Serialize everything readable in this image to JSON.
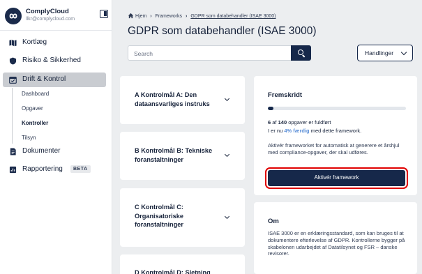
{
  "sidebar": {
    "org": {
      "name": "ComplyCloud",
      "email": "llkr@complycloud.com"
    },
    "items": [
      {
        "label": "Kortlæg",
        "icon": "map-icon"
      },
      {
        "label": "Risiko & Sikkerhed",
        "icon": "shield-icon"
      },
      {
        "label": "Drift & Kontrol",
        "icon": "calendar-check-icon",
        "active": true
      },
      {
        "label": "Dokumenter",
        "icon": "document-icon"
      },
      {
        "label": "Rapportering",
        "icon": "report-icon",
        "badge": "BETA"
      }
    ],
    "subitems": [
      {
        "label": "Dashboard"
      },
      {
        "label": "Opgaver"
      },
      {
        "label": "Kontroller",
        "active": true
      },
      {
        "label": "Tilsyn"
      }
    ]
  },
  "breadcrumb": {
    "home": "Hjem",
    "section": "Frameworks",
    "current": "GDPR som databehandler (ISAE 3000)"
  },
  "page_title": "GDPR som databehandler (ISAE 3000)",
  "search": {
    "placeholder": "Search"
  },
  "actions": {
    "label": "Handlinger"
  },
  "controls": [
    {
      "title": "A Kontrolmål A: Den dataansvarliges instruks"
    },
    {
      "title": "B Kontrolmål B: Tekniske foranstaltninger"
    },
    {
      "title": "C Kontrolmål C: Organisatoriske foranstaltninger"
    },
    {
      "title": "D Kontrolmål D: Sletning"
    }
  ],
  "progress": {
    "title": "Fremskridt",
    "fraction": 0.04,
    "done": "6",
    "of_text": " af ",
    "total": "140",
    "tasks_text": " opgaver er fuldført",
    "line2_prefix": "I er nu ",
    "percent_text": "4% færdig",
    "line2_suffix": " med dette framework.",
    "description": "Aktivér frameworket for automatisk at generere et årshjul med compliance-opgaver, der skal udføres.",
    "button_label": "Aktivér framework"
  },
  "about": {
    "title": "Om",
    "text": "ISAE 3000 er en erklæringsstandard, som kan bruges til at dokumentere efterlevelse af GDPR. Kontrollerne bygger på skabelonen udarbejdet af Datatilsynet og FSR – danske revisorer."
  },
  "colors": {
    "primary": "#16284a",
    "accent": "#5b8fd8",
    "highlight": "#e00000",
    "background": "#eceef0"
  }
}
